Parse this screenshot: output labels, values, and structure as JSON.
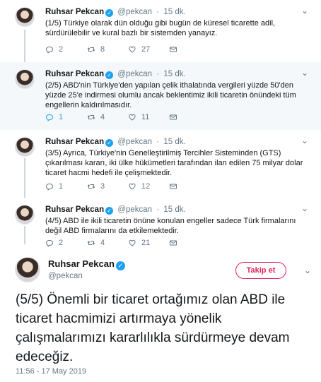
{
  "tweets": [
    {
      "name": "Ruhsar Pekcan",
      "handle": "@pekcan",
      "time": "15 dk.",
      "text": "(1/5) Türkiye olarak dün olduğu gibi bugün de küresel ticarette adil, sürdürülebilir ve kural bazlı bir sistemden yanayız.",
      "replies": "2",
      "retweets": "8",
      "likes": "27"
    },
    {
      "name": "Ruhsar Pekcan",
      "handle": "@pekcan",
      "time": "15 dk.",
      "text": "(2/5) ABD'nin Türkiye'den yapılan çelik ithalatında vergileri yüzde 50'den yüzde 25'e indirmesi olumlu ancak beklentimiz ikili ticaretin önündeki tüm engellerin kaldırılmasıdır.",
      "replies": "1",
      "retweets": "4",
      "likes": "11"
    },
    {
      "name": "Ruhsar Pekcan",
      "handle": "@pekcan",
      "time": "15 dk.",
      "text": "(3/5) Ayrıca, Türkiye'nin Genelleştirilmiş Tercihler Sisteminden (GTS) çıkarılması kararı, iki ülke hükümetleri tarafından ilan edilen 75 milyar dolar ticaret hacmi hedefi ile çelişmektedir.",
      "replies": "1",
      "retweets": "3",
      "likes": "12"
    },
    {
      "name": "Ruhsar Pekcan",
      "handle": "@pekcan",
      "time": "15 dk.",
      "text": "(4/5) ABD ile ikili ticaretin önüne konulan engeller sadece Türk firmalarını değil ABD firmalarını da etkilemektedir.",
      "replies": "2",
      "retweets": "4",
      "likes": "21"
    }
  ],
  "main": {
    "name": "Ruhsar Pekcan",
    "handle": "@pekcan",
    "follow_label": "Takip et",
    "text": "(5/5) Önemli bir ticaret ortağımız olan ABD ile ticaret hacmimizi artırmaya yönelik çalışmalarımızı kararlılıkla sürdürmeye devam edeceğiz.",
    "timestamp": "11:56 - 17 May 2019"
  },
  "icons": {
    "verified": "verified-badge-icon",
    "reply": "reply-icon",
    "retweet": "retweet-icon",
    "like": "heart-icon",
    "dm": "envelope-icon",
    "caret": "chevron-down-icon"
  },
  "colors": {
    "accent": "#1da1f2",
    "follow": "#e0245e",
    "muted": "#657786",
    "highlight_bg": "#f5f8fa"
  }
}
